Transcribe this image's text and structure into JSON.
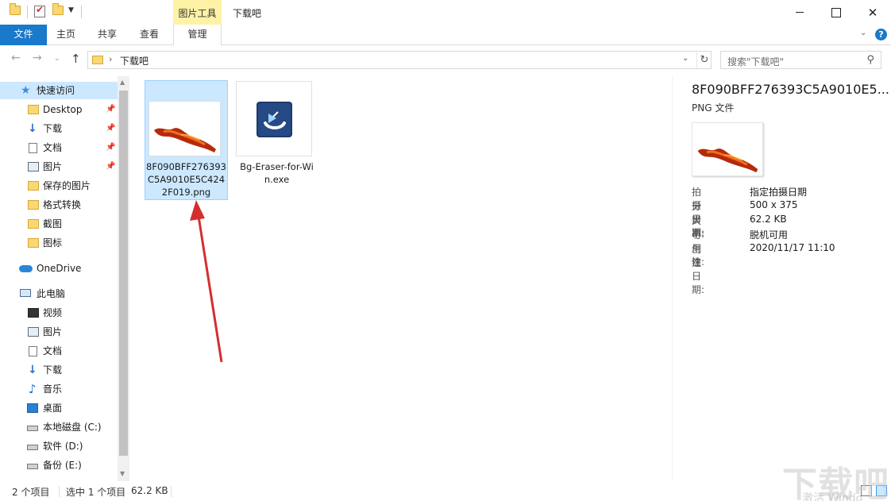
{
  "titlebar": {
    "context_tab_head": "图片工具",
    "title": "下载吧"
  },
  "ribbon": {
    "tabs": [
      {
        "label": "文件"
      },
      {
        "label": "主页"
      },
      {
        "label": "共享"
      },
      {
        "label": "查看"
      },
      {
        "label": "管理"
      }
    ],
    "help_label": "?"
  },
  "address": {
    "path": "下载吧",
    "search_placeholder": "搜索\"下载吧\""
  },
  "navpane": {
    "quick_access": "快速访问",
    "quick_items": [
      {
        "label": "Desktop",
        "icon": "folder-icon",
        "pinned": true
      },
      {
        "label": "下载",
        "icon": "download-icon",
        "pinned": true
      },
      {
        "label": "文档",
        "icon": "document-icon",
        "pinned": true
      },
      {
        "label": "图片",
        "icon": "picture-icon",
        "pinned": true
      },
      {
        "label": "保存的图片",
        "icon": "folder-icon",
        "pinned": false
      },
      {
        "label": "格式转换",
        "icon": "folder-icon",
        "pinned": false
      },
      {
        "label": "截图",
        "icon": "folder-icon",
        "pinned": false
      },
      {
        "label": "图标",
        "icon": "folder-icon",
        "pinned": false
      }
    ],
    "onedrive": "OneDrive",
    "this_pc": "此电脑",
    "pc_items": [
      {
        "label": "视频",
        "icon": "video-icon"
      },
      {
        "label": "图片",
        "icon": "picture-icon"
      },
      {
        "label": "文档",
        "icon": "document-icon"
      },
      {
        "label": "下载",
        "icon": "download-icon"
      },
      {
        "label": "音乐",
        "icon": "music-icon"
      },
      {
        "label": "桌面",
        "icon": "desktop-icon"
      },
      {
        "label": "本地磁盘 (C:)",
        "icon": "drive-icon"
      },
      {
        "label": "软件 (D:)",
        "icon": "drive-icon"
      },
      {
        "label": "备份 (E:)",
        "icon": "drive-icon"
      }
    ]
  },
  "files": [
    {
      "name": "8F090BFF276393C5A9010E5C4242F019.png",
      "selected": true
    },
    {
      "name": "Bg-Eraser-for-Win.exe",
      "selected": false
    }
  ],
  "details": {
    "title": "8F090BFF276393C5A9010E5...",
    "type": "PNG 文件",
    "props": [
      {
        "key": "拍摄日期:",
        "value": "指定拍摄日期"
      },
      {
        "key": "分辨率:",
        "value": "500 x 375"
      },
      {
        "key": "大小:",
        "value": "62.2 KB"
      },
      {
        "key": "可用性:",
        "value": "脱机可用"
      },
      {
        "key": "创建日期:",
        "value": "2020/11/17 11:10"
      }
    ]
  },
  "status": {
    "count": "2 个项目",
    "selected": "选中 1 个项目",
    "size": "62.2 KB"
  },
  "watermark": {
    "main": "下载吧",
    "sub": "激活 Windo"
  },
  "colors": {
    "accent": "#1979ca",
    "selection": "#cce8ff",
    "arrow": "#d32f2f"
  }
}
